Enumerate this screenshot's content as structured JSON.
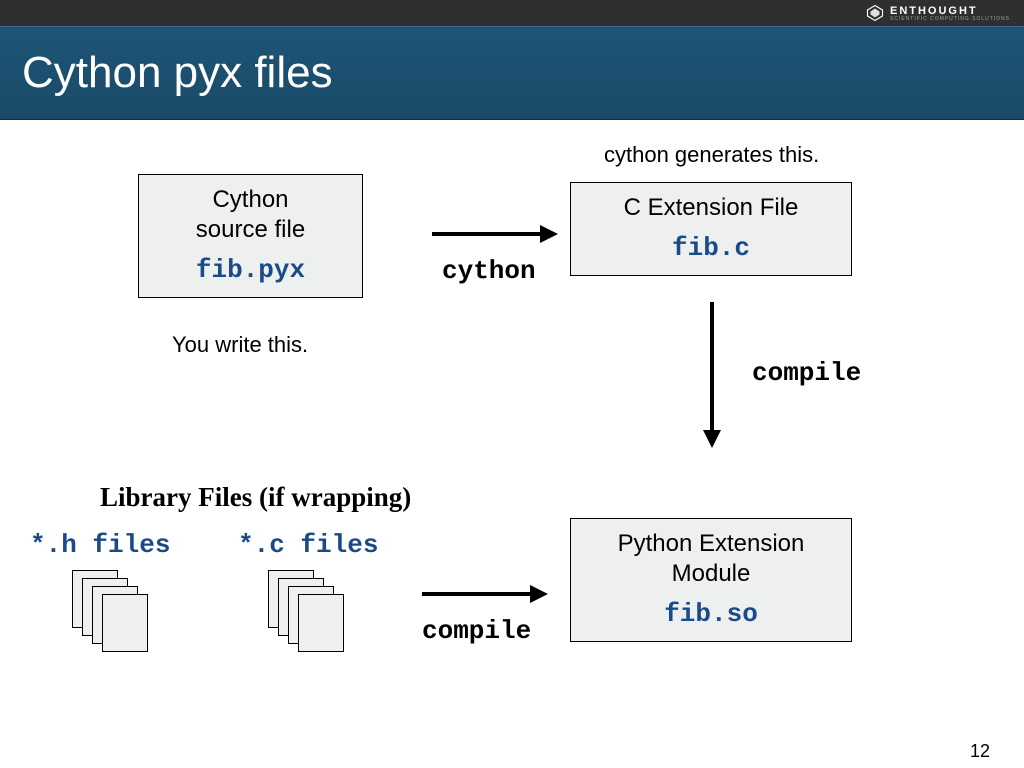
{
  "brand": {
    "name": "ENTHOUGHT",
    "tagline": "SCIENTIFIC COMPUTING SOLUTIONS"
  },
  "title": "Cython pyx files",
  "box1": {
    "title1": "Cython",
    "title2": "source file",
    "file": "fib.pyx",
    "caption": "You write this."
  },
  "box2": {
    "title": "C Extension File",
    "file": "fib.c",
    "caption": "cython generates this."
  },
  "box3": {
    "title1": "Python Extension",
    "title2": "Module",
    "file": "fib.so"
  },
  "arrow1_label": "cython",
  "arrow2_label": "compile",
  "arrow3_label": "compile",
  "library": {
    "header": "Library Files (if wrapping)",
    "h": "*.h files",
    "c": "*.c files"
  },
  "page_number": "12"
}
